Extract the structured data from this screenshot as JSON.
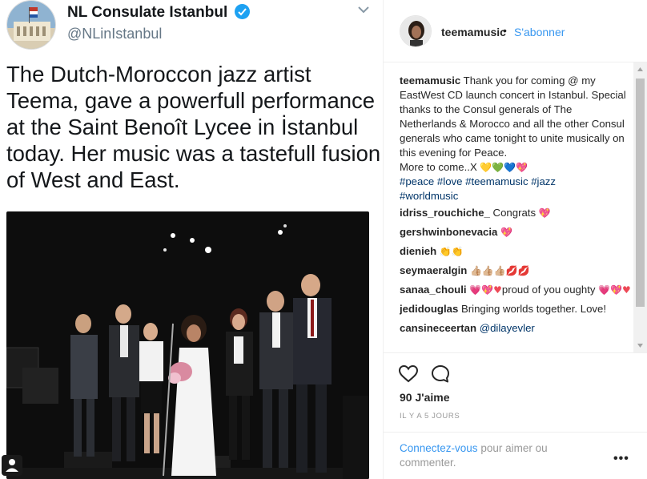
{
  "tweet": {
    "display_name": "NL Consulate Istanbul",
    "handle": "@NLinIstanbul",
    "text": "The Dutch-Moroccon jazz artist Teema, gave a powerfull performance at the Saint Benoît Lycee in İstanbul today. Her music was a tastefull fusion of West and East.",
    "verified_icon": "verified-badge",
    "menu_icon": "chevron-down"
  },
  "instagram": {
    "header": {
      "username": "teemamusic",
      "separator": "•",
      "follow_label": "S'abonner"
    },
    "caption": {
      "username": "teemamusic",
      "text": "Thank you for coming @ my EastWest CD launch concert in Istanbul. Special thanks to the Consul generals of The Netherlands & Morocco and all the other Consul generals who came tonight to unite musically on this evening for Peace.",
      "more_line": "More to come..X",
      "more_emoji": "💛💚💙💖",
      "hashtags_line1": "#peace #love #teemamusic #jazz",
      "hashtags_line2": "#worldmusic"
    },
    "comments": [
      {
        "username": "idriss_rouchiche_",
        "text": "Congrats",
        "emoji": "💖"
      },
      {
        "username": "gershwinbonevacia",
        "text": "",
        "emoji": "💖"
      },
      {
        "username": "dienieh",
        "text": "",
        "emoji": "👏👏"
      },
      {
        "username": "seymaeralgin",
        "text": "",
        "emoji": "👍🏼👍🏼👍🏼💋💋"
      },
      {
        "username": "sanaa_chouli",
        "text": "proud of you oughty",
        "emoji_pre": "💗💖♥",
        "emoji_post": "💗💖♥"
      },
      {
        "username": "jedidouglas",
        "text": "Bringing worlds together. Love!",
        "emoji": ""
      },
      {
        "username": "cansineceertan",
        "text": "@dilayevler",
        "emoji": ""
      }
    ],
    "likes": "90 J'aime",
    "time_ago": "IL Y A 5 JOURS",
    "login_link": "Connectez-vous",
    "login_rest": " pour aimer ou commenter.",
    "more_options": "•••"
  },
  "colors": {
    "link_blue": "#3897f0",
    "hashtag": "#003569",
    "twitter_blue": "#1da1f2",
    "heart": "#ed4956"
  }
}
